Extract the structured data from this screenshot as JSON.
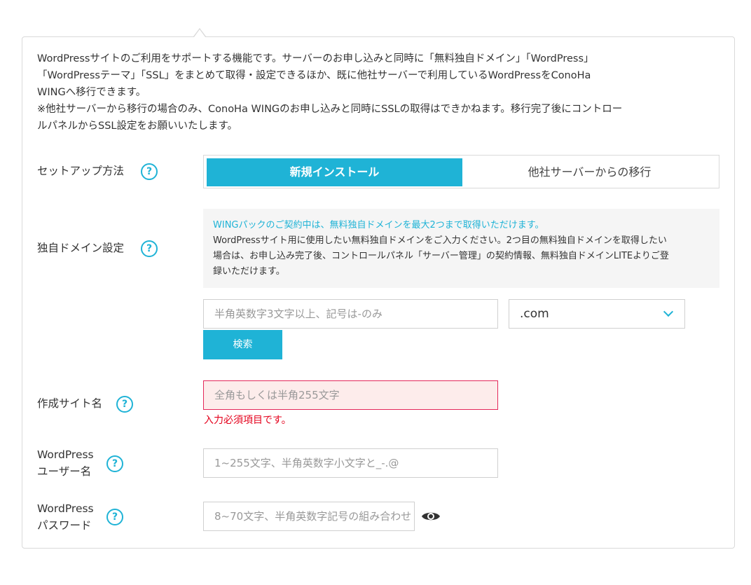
{
  "description": {
    "lines": [
      "WordPressサイトのご利用をサポートする機能です。サーバーのお申し込みと同時に「無料独自ドメイン」「WordPress」",
      "「WordPressテーマ」「SSL」をまとめて取得・設定できるほか、既に他社サーバーで利用しているWordPressをConoHa",
      "WINGへ移行できます。",
      "※他社サーバーから移行の場合のみ、ConoHa WINGのお申し込みと同時にSSLの取得はできかねます。移行完了後にコントロー",
      "ルパネルからSSL設定をお願いいたします。"
    ]
  },
  "help_glyph": "?",
  "setup": {
    "label": "セットアップ方法",
    "options": [
      "新規インストール",
      "他社サーバーからの移行"
    ],
    "selected": "新規インストール"
  },
  "domain": {
    "label": "独自ドメイン設定",
    "info_lead": "WINGパックのご契約中は、無料独自ドメインを最大2つまで取得いただけます。",
    "info_body_lines": [
      "WordPressサイト用に使用したい無料独自ドメインをご入力ください。2つ目の無料独自ドメインを取得したい",
      "場合は、お申し込み完了後、コントロールパネル「サーバー管理」の契約情報、無料独自ドメインLITEよりご登",
      "録いただけます。"
    ],
    "input_placeholder": "半角英数字3文字以上、記号は-のみ",
    "tld_value": ".com",
    "search_button": "検索"
  },
  "site_name": {
    "label": "作成サイト名",
    "placeholder": "全角もしくは半角255文字",
    "error": "入力必須項目です。"
  },
  "wp_user": {
    "label_line1": "WordPress",
    "label_line2": "ユーザー名",
    "placeholder": "1~255文字、半角英数字小文字と_-.@"
  },
  "wp_pass": {
    "label_line1": "WordPress",
    "label_line2": "パスワード",
    "placeholder": "8~70文字、半角英数字記号の組み合わせ"
  },
  "colors": {
    "accent": "#1fb3d6",
    "error": "#e4001b",
    "error_border": "#e4285a"
  },
  "icons": {
    "help": "question-circle-icon",
    "show_password": "eye-icon",
    "dropdown": "chevron-down-icon"
  }
}
